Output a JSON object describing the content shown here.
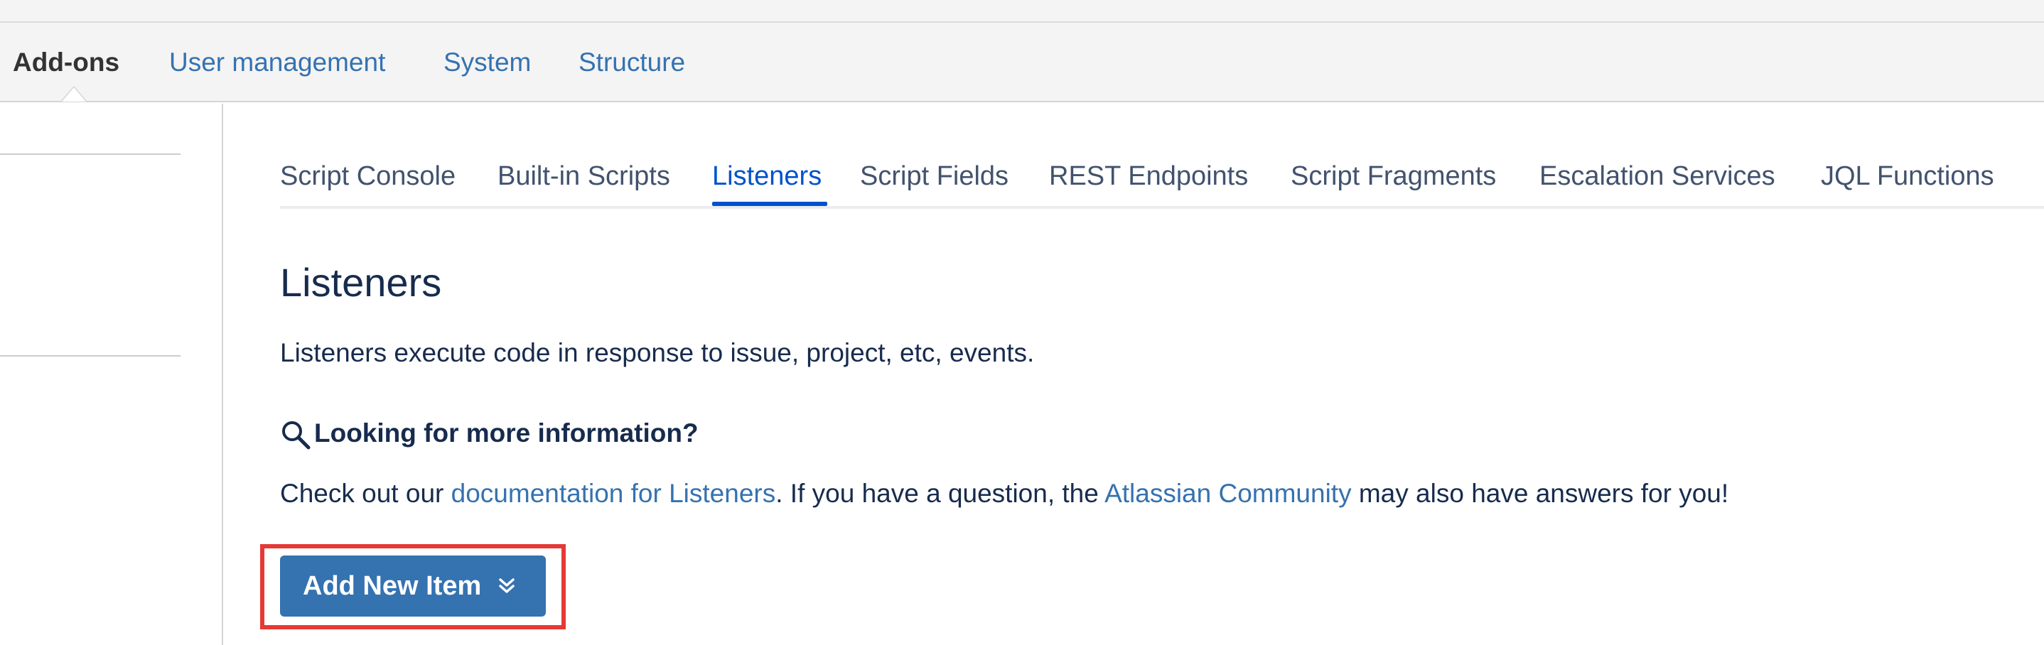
{
  "admin_nav": {
    "items": [
      {
        "label": "Add-ons",
        "active": true
      },
      {
        "label": "User management",
        "active": false
      },
      {
        "label": "System",
        "active": false
      },
      {
        "label": "Structure",
        "active": false
      }
    ]
  },
  "tabs": [
    {
      "label": "Script Console",
      "active": false
    },
    {
      "label": "Built-in Scripts",
      "active": false
    },
    {
      "label": "Listeners",
      "active": true
    },
    {
      "label": "Script Fields",
      "active": false
    },
    {
      "label": "REST Endpoints",
      "active": false
    },
    {
      "label": "Script Fragments",
      "active": false
    },
    {
      "label": "Escalation Services",
      "active": false
    },
    {
      "label": "JQL Functions",
      "active": false
    }
  ],
  "page": {
    "title": "Listeners",
    "description": "Listeners execute code in response to issue, project, etc, events."
  },
  "info": {
    "icon": "magnifier-icon",
    "heading": "Looking for more information?",
    "text_before": "Check out our ",
    "doc_link": "documentation for Listeners",
    "text_middle": ". If you have a question, the ",
    "community_link": "Atlassian Community",
    "text_after": " may also have answers for you!"
  },
  "add_button": {
    "label": "Add New Item",
    "icon": "double-chevron-down-icon"
  },
  "colors": {
    "link": "#3572b0",
    "active_tab": "#0052cc",
    "button_bg": "#3572b0",
    "highlight": "#e53935",
    "nav_bg": "#f4f4f4"
  }
}
